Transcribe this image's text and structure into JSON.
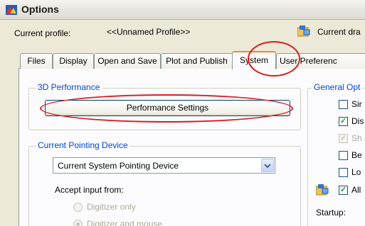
{
  "window": {
    "title": "Options"
  },
  "profile": {
    "current_profile_label": "Current profile:",
    "current_profile_value": "<<Unnamed Profile>>",
    "current_drawing_label": "Current dra"
  },
  "tabs": [
    {
      "label": "Files"
    },
    {
      "label": "Display"
    },
    {
      "label": "Open and Save"
    },
    {
      "label": "Plot and Publish"
    },
    {
      "label": "System"
    },
    {
      "label": "User Preferenc"
    }
  ],
  "active_tab": "System",
  "perf_group": {
    "title": "3D Performance",
    "button_label": "Performance Settings"
  },
  "pointing_group": {
    "title": "Current Pointing Device",
    "selected_value": "Current System Pointing Device",
    "accept_label": "Accept input from:",
    "options": [
      {
        "label": "Digitizer only"
      },
      {
        "label": "Digitizer and mouse"
      }
    ]
  },
  "general_group": {
    "title": "General Opt",
    "checkboxes": [
      {
        "label": "Sir",
        "checked": false,
        "disabled": false
      },
      {
        "label": "Dis",
        "checked": true,
        "disabled": false
      },
      {
        "label": "Sh",
        "checked": true,
        "disabled": true
      },
      {
        "label": "Be",
        "checked": false,
        "disabled": false
      },
      {
        "label": "Lo",
        "checked": false,
        "disabled": false
      },
      {
        "label": "All",
        "checked": true,
        "disabled": false
      }
    ],
    "startup_label": "Startup:"
  },
  "annotation_color": "#d81e1e"
}
